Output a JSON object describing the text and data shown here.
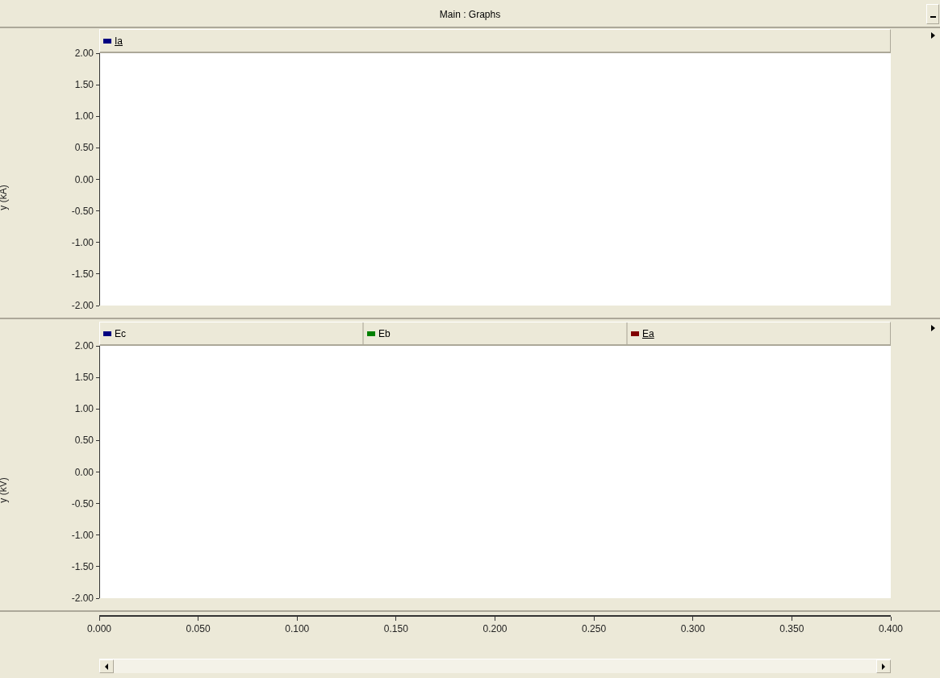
{
  "window": {
    "title": "Main : Graphs"
  },
  "graphs": [
    {
      "ylabel": "y (kA)",
      "legend": [
        {
          "label": "Ia",
          "color": "#000080",
          "selected": true
        }
      ],
      "yticks": [
        "2.00",
        "1.50",
        "1.00",
        "0.50",
        "0.00",
        "-0.50",
        "-1.00",
        "-1.50",
        "-2.00"
      ]
    },
    {
      "ylabel": "y (kV)",
      "legend": [
        {
          "label": "Ec",
          "color": "#000080",
          "selected": false
        },
        {
          "label": "Eb",
          "color": "#008000",
          "selected": false
        },
        {
          "label": "Ea",
          "color": "#800000",
          "selected": true
        }
      ],
      "yticks": [
        "2.00",
        "1.50",
        "1.00",
        "0.50",
        "0.00",
        "-0.50",
        "-1.00",
        "-1.50",
        "-2.00"
      ]
    }
  ],
  "x_axis": {
    "ticks": [
      "0.000",
      "0.050",
      "0.100",
      "0.150",
      "0.200",
      "0.250",
      "0.300",
      "0.350",
      "0.400"
    ]
  }
}
